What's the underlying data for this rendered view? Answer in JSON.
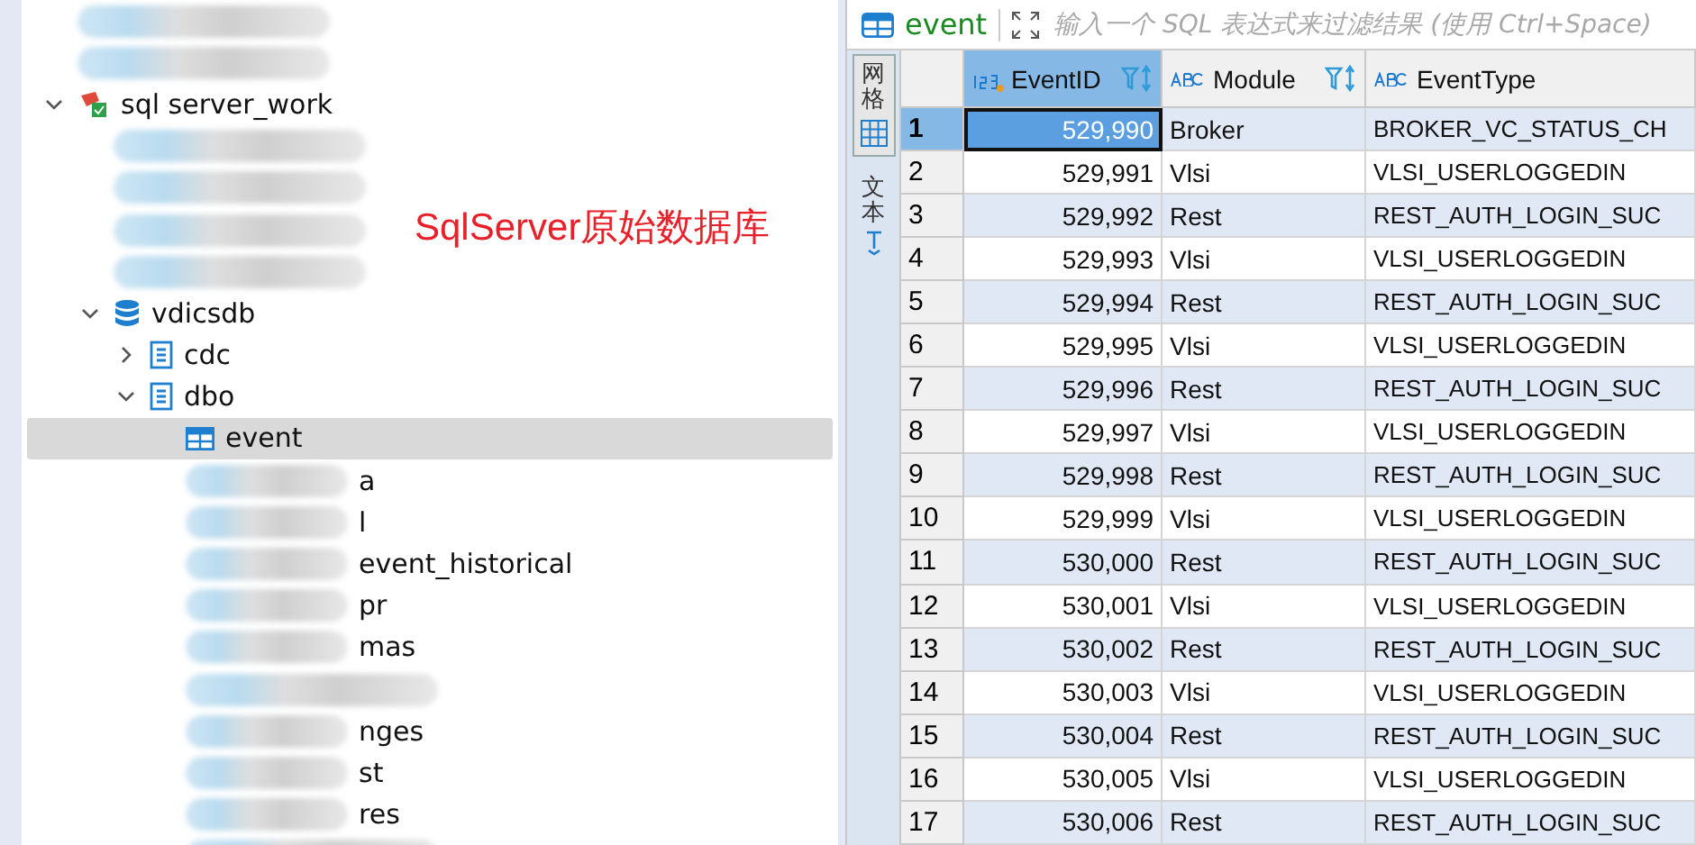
{
  "tree": [
    {
      "kind": "redacted"
    },
    {
      "kind": "redacted"
    },
    {
      "label": "sql server_work",
      "kind": "connection",
      "expanded": true,
      "children": [
        {
          "kind": "redacted"
        },
        {
          "kind": "redacted"
        },
        {
          "kind": "redacted"
        },
        {
          "kind": "redacted"
        },
        {
          "label": "vdicsdb",
          "kind": "database",
          "expanded": true,
          "children": [
            {
              "label": "cdc",
              "kind": "schema",
              "expanded": false
            },
            {
              "label": "dbo",
              "kind": "schema",
              "expanded": true,
              "children": [
                {
                  "label": "event",
                  "kind": "table",
                  "selected": true
                },
                {
                  "label": "a",
                  "kind": "redacted",
                  "selected": false
                },
                {
                  "label": "l",
                  "kind": "redacted",
                  "selected": false
                },
                {
                  "label": "event_historical",
                  "kind": "redacted",
                  "selected": false
                },
                {
                  "label": "pr",
                  "kind": "redacted",
                  "selected": false
                },
                {
                  "label": "mas",
                  "kind": "redacted",
                  "selected": false
                },
                {
                  "kind": "redacted",
                  "selected": false
                },
                {
                  "label": "nges",
                  "kind": "redacted",
                  "selected": false
                },
                {
                  "label": "st",
                  "kind": "redacted",
                  "selected": false
                },
                {
                  "label": "res",
                  "kind": "redacted",
                  "selected": false
                },
                {
                  "kind": "redacted",
                  "selected": false
                }
              ]
            }
          ]
        }
      ]
    }
  ],
  "annotation": "SqlServer原始数据库",
  "editor": {
    "table_name": "event",
    "filter": {
      "placeholder": "输入一个 SQL 表达式来过滤结果 (使用 Ctrl+Space)"
    }
  },
  "view_tabs": [
    {
      "label": "网格",
      "selected": true,
      "kind": "grid"
    },
    {
      "label": "文本",
      "selected": false,
      "kind": "text"
    }
  ],
  "table": {
    "columns": [
      {
        "label": "EventID",
        "kind": "number",
        "selected": true,
        "filter": true
      },
      {
        "label": "Module",
        "kind": "text",
        "selected": false,
        "filter": true
      },
      {
        "label": "EventType",
        "kind": "text",
        "selected": false,
        "filter": false
      }
    ],
    "rows": [
      {
        "num": "1",
        "selected": true,
        "cells": [
          "529,990",
          "Broker",
          "BROKER_VC_STATUS_CH"
        ]
      },
      {
        "num": "2",
        "selected": false,
        "cells": [
          "529,991",
          "Vlsi",
          "VLSI_USERLOGGEDIN"
        ]
      },
      {
        "num": "3",
        "selected": false,
        "cells": [
          "529,992",
          "Rest",
          "REST_AUTH_LOGIN_SUC"
        ]
      },
      {
        "num": "4",
        "selected": false,
        "cells": [
          "529,993",
          "Vlsi",
          "VLSI_USERLOGGEDIN"
        ]
      },
      {
        "num": "5",
        "selected": false,
        "cells": [
          "529,994",
          "Rest",
          "REST_AUTH_LOGIN_SUC"
        ]
      },
      {
        "num": "6",
        "selected": false,
        "cells": [
          "529,995",
          "Vlsi",
          "VLSI_USERLOGGEDIN"
        ]
      },
      {
        "num": "7",
        "selected": false,
        "cells": [
          "529,996",
          "Rest",
          "REST_AUTH_LOGIN_SUC"
        ]
      },
      {
        "num": "8",
        "selected": false,
        "cells": [
          "529,997",
          "Vlsi",
          "VLSI_USERLOGGEDIN"
        ]
      },
      {
        "num": "9",
        "selected": false,
        "cells": [
          "529,998",
          "Rest",
          "REST_AUTH_LOGIN_SUC"
        ]
      },
      {
        "num": "10",
        "selected": false,
        "cells": [
          "529,999",
          "Vlsi",
          "VLSI_USERLOGGEDIN"
        ]
      },
      {
        "num": "11",
        "selected": false,
        "cells": [
          "530,000",
          "Rest",
          "REST_AUTH_LOGIN_SUC"
        ]
      },
      {
        "num": "12",
        "selected": false,
        "cells": [
          "530,001",
          "Vlsi",
          "VLSI_USERLOGGEDIN"
        ]
      },
      {
        "num": "13",
        "selected": false,
        "cells": [
          "530,002",
          "Rest",
          "REST_AUTH_LOGIN_SUC"
        ]
      },
      {
        "num": "14",
        "selected": false,
        "cells": [
          "530,003",
          "Vlsi",
          "VLSI_USERLOGGEDIN"
        ]
      },
      {
        "num": "15",
        "selected": false,
        "cells": [
          "530,004",
          "Rest",
          "REST_AUTH_LOGIN_SUC"
        ]
      },
      {
        "num": "16",
        "selected": false,
        "cells": [
          "530,005",
          "Vlsi",
          "VLSI_USERLOGGEDIN"
        ]
      },
      {
        "num": "17",
        "selected": false,
        "cells": [
          "530,006",
          "Rest",
          "REST_AUTH_LOGIN_SUC"
        ]
      }
    ]
  }
}
